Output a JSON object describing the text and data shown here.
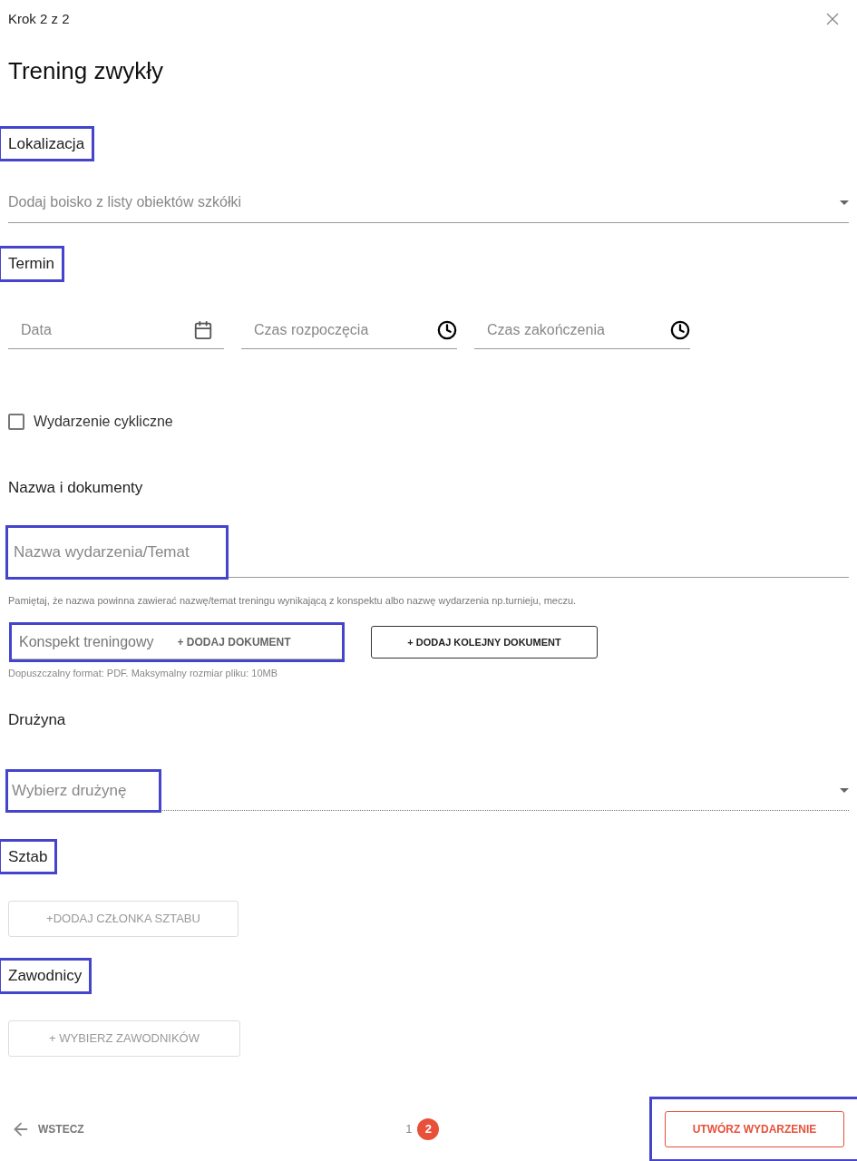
{
  "header": {
    "step": "Krok 2 z 2",
    "title": "Trening zwykły"
  },
  "location": {
    "heading": "Lokalizacja",
    "highlighted": true,
    "placeholder": "Dodaj boisko z listy obiektów szkółki"
  },
  "term": {
    "heading": "Termin",
    "highlighted": true,
    "fields": [
      {
        "placeholder": "Data",
        "kind": "date"
      },
      {
        "placeholder": "Czas rozpoczęcia",
        "kind": "time"
      },
      {
        "placeholder": "Czas zakończenia",
        "kind": "time"
      }
    ]
  },
  "recurring": {
    "label": "Wydarzenie cykliczne",
    "checked": false
  },
  "documents": {
    "heading": "Nazwa i dokumenty",
    "highlighted": false,
    "name_field": {
      "placeholder": "Nazwa wydarzenia/Temat",
      "highlighted": true
    },
    "name_hint": "Pamiętaj, że nazwa powinna zawierać nazwę/temat treningu wynikającą z konspektu albo nazwę wydarzenia np.turnieju, meczu.",
    "plan_field": {
      "placeholder": "Konspekt treningowy",
      "button": "+ DODAJ DOKUMENT",
      "highlighted": true
    },
    "add_another": "+ DODAJ KOLEJNY DOKUMENT",
    "format_hint": "Dopuszczalny format: PDF. Maksymalny rozmiar pliku: 10MB"
  },
  "team": {
    "heading": "Drużyna",
    "highlighted": false,
    "placeholder": "Wybierz drużynę",
    "placeholder_highlighted": true
  },
  "staff": {
    "heading": "Sztab",
    "highlighted": true,
    "button": "+DODAJ CZŁONKA SZTABU",
    "disabled": true
  },
  "players": {
    "heading": "Zawodnicy",
    "highlighted": true,
    "button": "+ WYBIERZ ZAWODNIKÓW",
    "disabled": true
  },
  "footer": {
    "back": "WSTECZ",
    "pages": [
      {
        "label": "1",
        "selected": false
      },
      {
        "label": "2",
        "selected": true
      }
    ],
    "submit": "UTWÓRZ WYDARZENIE",
    "submit_highlighted": true
  }
}
